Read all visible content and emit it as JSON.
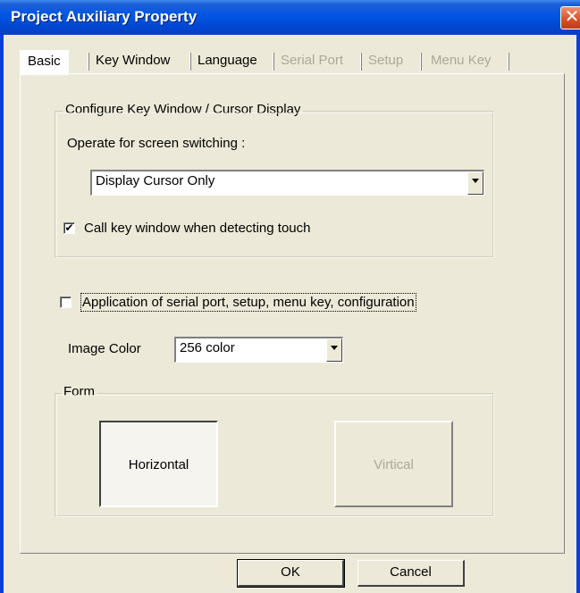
{
  "window": {
    "title": "Project Auxiliary Property",
    "close_glyph": "✕"
  },
  "tabs": [
    {
      "label": "Basic",
      "state": "active"
    },
    {
      "label": "Key Window",
      "state": "enabled"
    },
    {
      "label": "Language",
      "state": "enabled"
    },
    {
      "label": "Serial Port",
      "state": "disabled"
    },
    {
      "label": "Setup",
      "state": "disabled"
    },
    {
      "label": "Menu Key",
      "state": "disabled"
    }
  ],
  "key_window_group": {
    "label": "Configure Key Window / Cursor Display",
    "operate_label": "Operate for screen switching :",
    "operate_value": "Display Cursor Only",
    "call_key_checked": true,
    "call_key_label": "Call key window when detecting touch"
  },
  "serial_config": {
    "checked": false,
    "label": "Application of serial port, setup, menu key, configuration"
  },
  "image_color": {
    "label": "Image Color",
    "value": "256 color"
  },
  "form_group": {
    "label": "Form",
    "horizontal_label": "Horizontal",
    "vertical_label": "Virtical"
  },
  "footer": {
    "ok_label": "OK",
    "cancel_label": "Cancel"
  },
  "icons": {
    "checkmark": "✔",
    "dropdown": "chevron-down-icon",
    "close": "close-icon"
  },
  "colors": {
    "titlebar": "#0055e5",
    "close_button": "#d9532c",
    "face": "#ece9d8",
    "disabled_text": "#aca899"
  }
}
